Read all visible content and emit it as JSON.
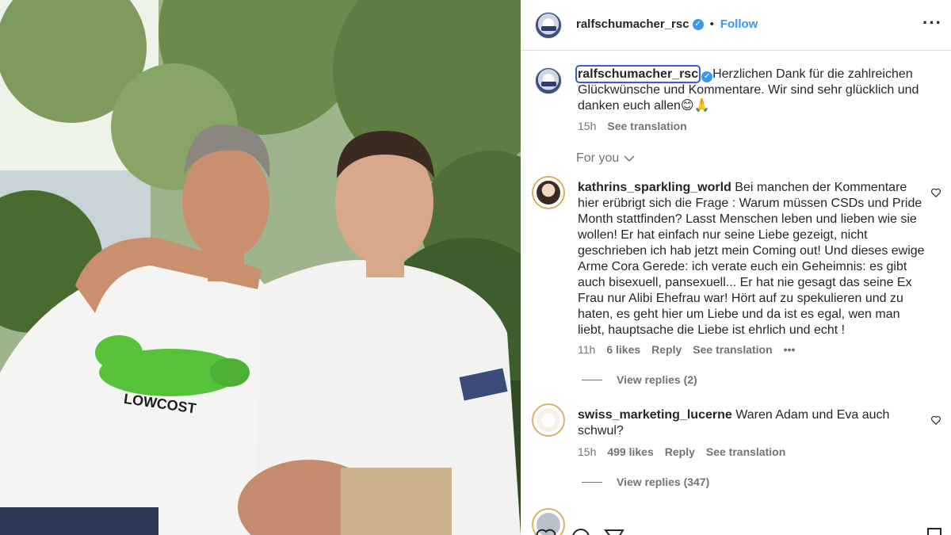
{
  "post": {
    "author": "ralfschumacher_rsc",
    "verified_icon": "verified-badge-icon",
    "separator": "•",
    "follow_label": "Follow",
    "more_icon": "more-options-icon",
    "caption_text": "Herzlichen Dank für die zahlreichen Glückwünsche und Kommentare. Wir sind sehr glücklich und danken euch allen😊🙏",
    "caption_time": "15h",
    "see_translation": "See translation"
  },
  "photo": {
    "shirt_print": "LOWCOST"
  },
  "for_you": {
    "label": "For you"
  },
  "comments": [
    {
      "username": "kathrins_sparkling_world",
      "text": "Bei manchen der Kommentare hier erübrigt sich die Frage : Warum müssen CSDs und Pride Month stattfinden? Lasst Menschen leben und lieben wie sie wollen! Er hat einfach nur seine Liebe gezeigt, nicht geschrieben ich hab jetzt mein Coming out! Und dieses ewige Arme Cora Gerede: ich verate euch ein Geheimnis: es gibt auch bisexuell, pansexuell... Er hat nie gesagt das seine Ex Frau nur Alibi Ehefrau war! Hört auf zu spekulieren und zu haten, es geht hier um Liebe und da ist es egal, wen man liebt, hauptsache die Liebe ist ehrlich und echt !",
      "time": "11h",
      "likes": "6 likes",
      "reply": "Reply",
      "see_translation": "See translation",
      "more": "•••",
      "view_replies": "View replies (2)"
    },
    {
      "username": "swiss_marketing_lucerne",
      "text": "Waren Adam und Eva auch schwul?",
      "time": "15h",
      "likes": "499 likes",
      "reply": "Reply",
      "see_translation": "See translation",
      "view_replies": "View replies (347)"
    }
  ],
  "colors": {
    "accent": "#3897f0",
    "text": "#262626",
    "muted": "#737373",
    "divider": "#dbdbdb"
  }
}
